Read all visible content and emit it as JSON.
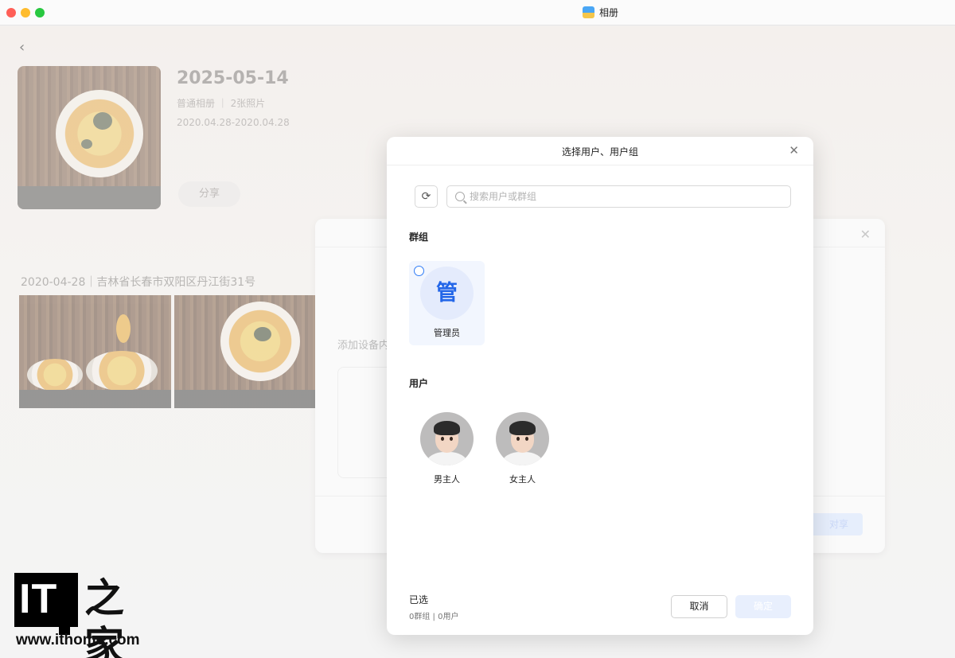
{
  "window": {
    "title": "相册",
    "icon": "photos-app-icon"
  },
  "album": {
    "title": "2025-05-14",
    "meta": "普通相册 ｜ 2张照片",
    "date_range": "2020.04.28-2020.04.28",
    "share_label": "分享"
  },
  "timeline": {
    "date_header": "2020-04-28｜吉林省长春市双阳区丹江街31号",
    "thumbnails": [
      "food-photo-1",
      "food-photo-2"
    ]
  },
  "background_dialog": {
    "add_label": "添加设备内",
    "confirm_fragment": "对享"
  },
  "dialog": {
    "title": "选择用户、用户组",
    "search_placeholder": "搜索用户或群组",
    "groups_label": "群组",
    "groups": [
      {
        "avatar_char": "管",
        "name": "管理员",
        "selected": false
      }
    ],
    "users_label": "用户",
    "users": [
      {
        "name": "男主人"
      },
      {
        "name": "女主人"
      }
    ],
    "selected_title": "已选",
    "selected_count": "0群组 | 0用户",
    "cancel_label": "取消",
    "confirm_label": "确定"
  },
  "watermark": {
    "logo_text": "IT",
    "logo_han": "之家",
    "url": "www.ithome.com"
  },
  "colors": {
    "accent": "#2f7cf6",
    "group_card_bg": "#f2f6fe",
    "confirm_disabled": "#e8effd"
  }
}
